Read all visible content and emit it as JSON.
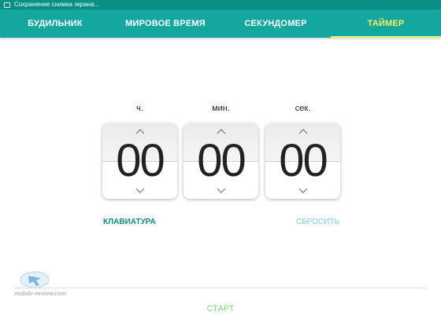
{
  "status_bar": {
    "text": "Сохранение снимка экрана..."
  },
  "tabs": [
    {
      "label": "БУДИЛЬНИК",
      "active": false
    },
    {
      "label": "МИРОВОЕ ВРЕМЯ",
      "active": false
    },
    {
      "label": "СЕКУНДОМЕР",
      "active": false
    },
    {
      "label": "ТАЙМЕР",
      "active": true
    }
  ],
  "timer": {
    "hours_label": "ч.",
    "minutes_label": "мин.",
    "seconds_label": "сек.",
    "hours": "00",
    "minutes": "00",
    "seconds": "00"
  },
  "actions": {
    "keyboard_label": "КЛАВИАТУРА",
    "reset_label": "СБРОСИТЬ",
    "start_label": "СТАРТ"
  },
  "watermark": {
    "text": "mobile-review.com"
  },
  "colors": {
    "tab_bar": "#14a79d",
    "active_tab": "#f4ef6a",
    "keyboard": "#108a81",
    "reset": "#7fcfcb",
    "start": "#7fd67f"
  }
}
